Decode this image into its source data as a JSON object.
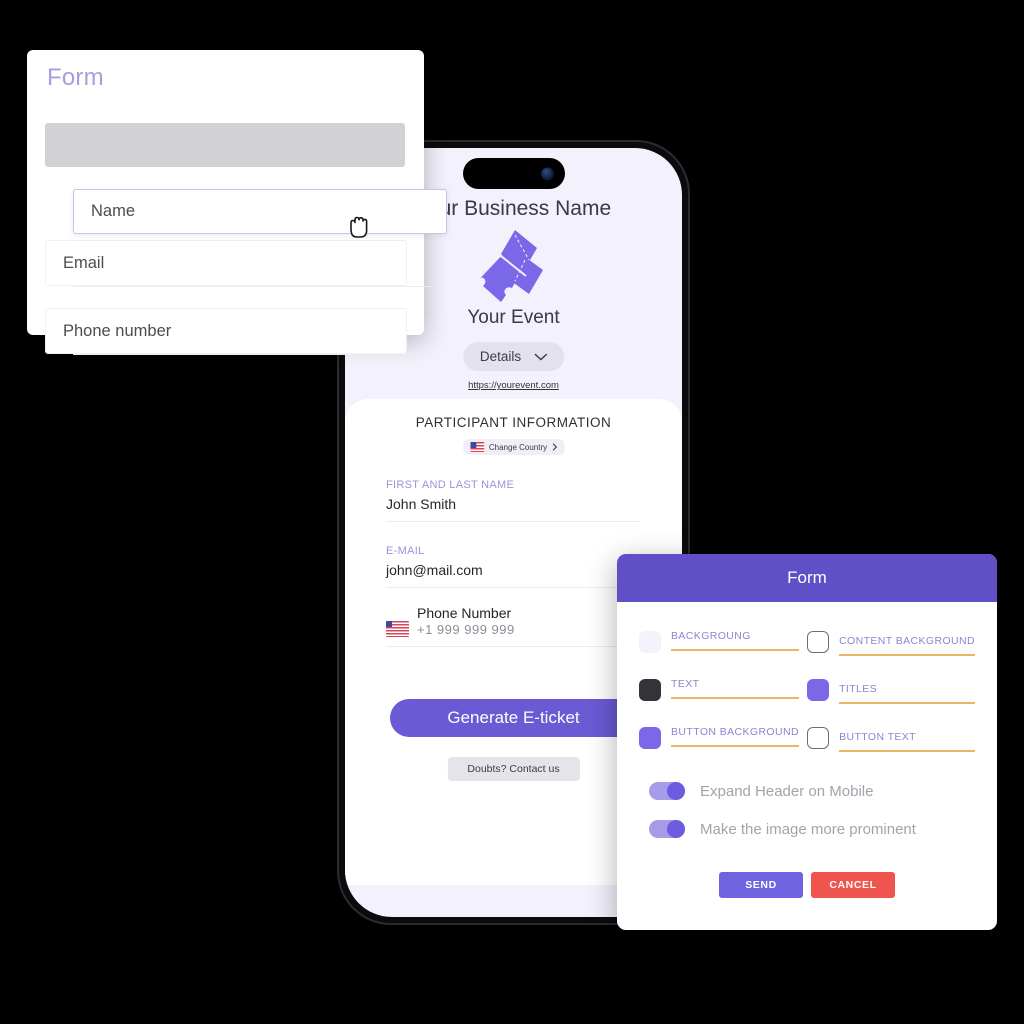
{
  "builder_card": {
    "title": "Form",
    "fields": [
      {
        "name": "name",
        "placeholder": "Name"
      },
      {
        "name": "email",
        "placeholder": "Email"
      },
      {
        "name": "phone",
        "placeholder": "Phone number"
      }
    ],
    "cursor_icon": "grab-hand-cursor"
  },
  "phone": {
    "business_name": "Your Business Name",
    "logo_icon": "event-tickets-icon",
    "event_name": "Your Event",
    "details_button": "Details",
    "details_chevron_icon": "chevron-down-icon",
    "event_url": "https://yourevent.com",
    "content": {
      "section_title": "PARTICIPANT INFORMATION",
      "country_chip": {
        "label": "Change Country",
        "flag_icon": "us-flag-icon",
        "chevron_icon": "chevron-right-icon"
      },
      "fields": [
        {
          "label": "FIRST AND LAST NAME",
          "value": "John Smith"
        },
        {
          "label": "E-MAIL",
          "value": "john@mail.com"
        }
      ],
      "phone_field": {
        "label": "Phone Number",
        "value": "+1 999 999 999",
        "flag_icon": "us-flag-icon"
      },
      "primary_button": "Generate E-ticket",
      "contact_button": "Doubts? Contact us"
    }
  },
  "settings_panel": {
    "title": "Form",
    "swatches": [
      {
        "label": "BACKGROUNG",
        "color": "#f4f2fd",
        "outline": false
      },
      {
        "label": "CONTENT BACKGROUND",
        "color": "#ffffff",
        "outline": true
      },
      {
        "label": "TEXT",
        "color": "#333338",
        "outline": false
      },
      {
        "label": "TITLES",
        "color": "#7b68e8",
        "outline": false
      },
      {
        "label": "BUTTON BACKGROUND",
        "color": "#7b68e8",
        "outline": false
      },
      {
        "label": "BUTTON TEXT",
        "color": "#ffffff",
        "outline": true
      }
    ],
    "toggles": [
      {
        "label": "Expand Header on Mobile",
        "on": true
      },
      {
        "label": "Make the image more prominent",
        "on": true
      }
    ],
    "buttons": {
      "send": "SEND",
      "cancel": "CANCEL"
    },
    "colors": {
      "header": "#6050c8",
      "underline": "#e8b868",
      "send": "#6f63e0",
      "cancel": "#f0544f"
    }
  }
}
